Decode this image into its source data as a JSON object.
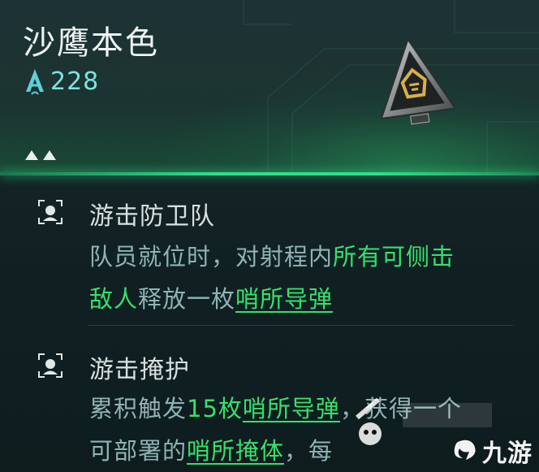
{
  "card": {
    "title": "沙鹰本色",
    "score": "228",
    "score_icon": "anchor-a-icon",
    "rank_count": 2,
    "colors": {
      "accent_green": "#37e06c",
      "score_cyan": "#7ee3e0",
      "desc_text": "#8fb3b5"
    }
  },
  "perks": [
    {
      "name": "游击防卫队",
      "icon": "target-reticle-icon",
      "desc_parts": [
        {
          "text": "队员就位时，对射程内",
          "style": "plain"
        },
        {
          "text": "所有可侧击",
          "style": "highlight"
        },
        {
          "text": "敌人",
          "style": "highlight"
        },
        {
          "text": "释放一枚",
          "style": "plain"
        },
        {
          "text": "哨所导弹",
          "style": "highlight-underline"
        }
      ]
    },
    {
      "name": "游击掩护",
      "icon": "target-reticle-icon",
      "desc_parts": [
        {
          "text": "累积触发",
          "style": "plain"
        },
        {
          "text": "15枚",
          "style": "highlight"
        },
        {
          "text": "哨所导弹",
          "style": "highlight-underline"
        },
        {
          "text": "，获得一个",
          "style": "plain"
        },
        {
          "text": "可部署的",
          "style": "plain"
        },
        {
          "text": "哨所掩体",
          "style": "highlight-underline"
        },
        {
          "text": "，每",
          "style": "plain"
        }
      ]
    }
  ],
  "watermark": {
    "text": "九游"
  }
}
